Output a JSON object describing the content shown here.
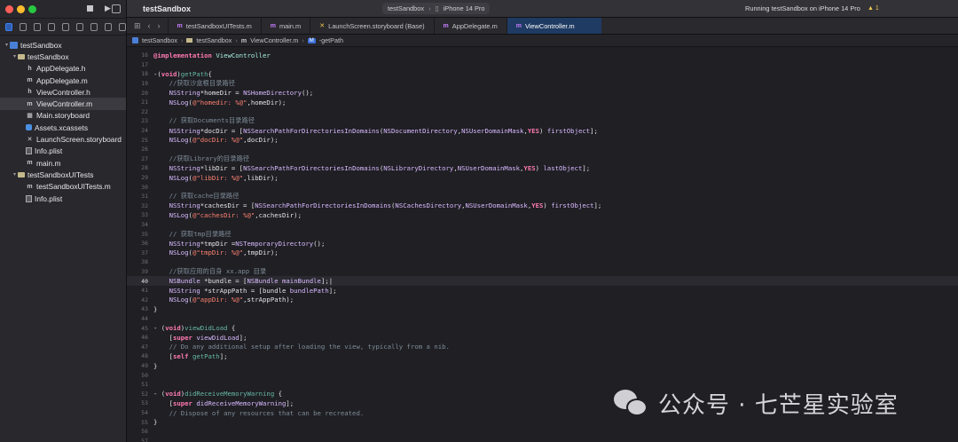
{
  "app": {
    "project_title": "testSandbox",
    "scheme": "testSandbox",
    "device": "iPhone 14 Pro",
    "status": "Running testSandbox on iPhone 14 Pro",
    "warnings": "1"
  },
  "colors": {
    "close": "#ff5f57",
    "minimize": "#febc2e",
    "zoom": "#28c840",
    "active_tab": "#1f3b63",
    "accent": "#3b82f6"
  },
  "navigator": {
    "items": [
      {
        "label": "testSandbox",
        "level": 0,
        "icon": "project-icon",
        "caret": "▾"
      },
      {
        "label": "testSandbox",
        "level": 1,
        "icon": "folder-icon",
        "caret": "▾"
      },
      {
        "label": "AppDelegate.h",
        "level": 2,
        "icon": "h-file-icon",
        "glyph": "h"
      },
      {
        "label": "AppDelegate.m",
        "level": 2,
        "icon": "m-file-icon",
        "glyph": "m"
      },
      {
        "label": "ViewController.h",
        "level": 2,
        "icon": "h-file-icon",
        "glyph": "h"
      },
      {
        "label": "ViewController.m",
        "level": 2,
        "icon": "m-file-icon",
        "glyph": "m",
        "selected": true
      },
      {
        "label": "Main.storyboard",
        "level": 2,
        "icon": "storyboard-icon",
        "glyph": "▦"
      },
      {
        "label": "Assets.xcassets",
        "level": 2,
        "icon": "assets-icon",
        "glyph": ""
      },
      {
        "label": "LaunchScreen.storyboard",
        "level": 2,
        "icon": "launchscreen-icon",
        "glyph": "✕"
      },
      {
        "label": "Info.plist",
        "level": 2,
        "icon": "plist-icon",
        "glyph": ""
      },
      {
        "label": "main.m",
        "level": 2,
        "icon": "m-file-icon",
        "glyph": "m"
      },
      {
        "label": "testSandboxUITests",
        "level": 1,
        "icon": "folder-icon",
        "caret": "▾"
      },
      {
        "label": "testSandboxUITests.m",
        "level": 2,
        "icon": "m-file-icon",
        "glyph": "m"
      },
      {
        "label": "Info.plist",
        "level": 2,
        "icon": "plist-icon",
        "glyph": ""
      }
    ]
  },
  "tabs": [
    {
      "ext": "m",
      "label": "testSandboxUITests.m"
    },
    {
      "ext": "m",
      "label": "main.m"
    },
    {
      "ext": "✕",
      "label": "LaunchScreen.storyboard (Base)"
    },
    {
      "ext": "m",
      "label": "AppDelegate.m"
    },
    {
      "ext": "m",
      "label": "ViewController.m",
      "active": true
    }
  ],
  "jumpbar": {
    "project": "testSandbox",
    "group": "testSandbox",
    "file": "ViewController.m",
    "method_badge": "M",
    "method": "-getPath"
  },
  "editor": {
    "current_line": 40,
    "lines": [
      {
        "n": 16,
        "tokens": [
          [
            "k",
            "@implementation"
          ],
          [
            "plain",
            " "
          ],
          [
            "cls",
            "ViewController"
          ]
        ]
      },
      {
        "n": 17,
        "tokens": []
      },
      {
        "n": 18,
        "tokens": [
          [
            "plain",
            "-("
          ],
          [
            "k",
            "void"
          ],
          [
            "plain",
            ")"
          ],
          [
            "fn",
            "getPath"
          ],
          [
            "plain",
            "{"
          ]
        ]
      },
      {
        "n": 19,
        "tokens": [
          [
            "cm",
            "    //获取沙盒根目录路径"
          ]
        ]
      },
      {
        "n": 20,
        "tokens": [
          [
            "plain",
            "    "
          ],
          [
            "t",
            "NSString"
          ],
          [
            "plain",
            "*homeDir = "
          ],
          [
            "t",
            "NSHomeDirectory"
          ],
          [
            "plain",
            "();"
          ]
        ]
      },
      {
        "n": 21,
        "tokens": [
          [
            "plain",
            "    "
          ],
          [
            "t",
            "NSLog"
          ],
          [
            "plain",
            "("
          ],
          [
            "str",
            "@\"homedir: %@\""
          ],
          [
            "plain",
            ",homeDir);"
          ]
        ]
      },
      {
        "n": 22,
        "tokens": []
      },
      {
        "n": 23,
        "tokens": [
          [
            "cm",
            "    // 获取Documents目录路径"
          ]
        ]
      },
      {
        "n": 24,
        "tokens": [
          [
            "plain",
            "    "
          ],
          [
            "t",
            "NSString"
          ],
          [
            "plain",
            "*docDir = ["
          ],
          [
            "t",
            "NSSearchPathForDirectoriesInDomains"
          ],
          [
            "plain",
            "("
          ],
          [
            "t",
            "NSDocumentDirectory"
          ],
          [
            "plain",
            ","
          ],
          [
            "t",
            "NSUserDomainMask"
          ],
          [
            "plain",
            ","
          ],
          [
            "k",
            "YES"
          ],
          [
            "plain",
            ") "
          ],
          [
            "t",
            "firstObject"
          ],
          [
            "plain",
            "];"
          ]
        ]
      },
      {
        "n": 25,
        "tokens": [
          [
            "plain",
            "    "
          ],
          [
            "t",
            "NSLog"
          ],
          [
            "plain",
            "("
          ],
          [
            "str",
            "@\"docDir: %@\""
          ],
          [
            "plain",
            ",docDir);"
          ]
        ]
      },
      {
        "n": 26,
        "tokens": []
      },
      {
        "n": 27,
        "tokens": [
          [
            "cm",
            "    //获取Library的目录路径"
          ]
        ]
      },
      {
        "n": 28,
        "tokens": [
          [
            "plain",
            "    "
          ],
          [
            "t",
            "NSString"
          ],
          [
            "plain",
            "*libDir = ["
          ],
          [
            "t",
            "NSSearchPathForDirectoriesInDomains"
          ],
          [
            "plain",
            "("
          ],
          [
            "t",
            "NSLibraryDirectory"
          ],
          [
            "plain",
            ","
          ],
          [
            "t",
            "NSUserDomainMask"
          ],
          [
            "plain",
            ","
          ],
          [
            "k",
            "YES"
          ],
          [
            "plain",
            ") "
          ],
          [
            "t",
            "lastObject"
          ],
          [
            "plain",
            "];"
          ]
        ]
      },
      {
        "n": 29,
        "tokens": [
          [
            "plain",
            "    "
          ],
          [
            "t",
            "NSLog"
          ],
          [
            "plain",
            "("
          ],
          [
            "str",
            "@\"libDir: %@\""
          ],
          [
            "plain",
            ",libDir);"
          ]
        ]
      },
      {
        "n": 30,
        "tokens": []
      },
      {
        "n": 31,
        "tokens": [
          [
            "cm",
            "    // 获取cache目录路径"
          ]
        ]
      },
      {
        "n": 32,
        "tokens": [
          [
            "plain",
            "    "
          ],
          [
            "t",
            "NSString"
          ],
          [
            "plain",
            "*cachesDir = ["
          ],
          [
            "t",
            "NSSearchPathForDirectoriesInDomains"
          ],
          [
            "plain",
            "("
          ],
          [
            "t",
            "NSCachesDirectory"
          ],
          [
            "plain",
            ","
          ],
          [
            "t",
            "NSUserDomainMask"
          ],
          [
            "plain",
            ","
          ],
          [
            "k",
            "YES"
          ],
          [
            "plain",
            ") "
          ],
          [
            "t",
            "firstObject"
          ],
          [
            "plain",
            "];"
          ]
        ]
      },
      {
        "n": 33,
        "tokens": [
          [
            "plain",
            "    "
          ],
          [
            "t",
            "NSLog"
          ],
          [
            "plain",
            "("
          ],
          [
            "str",
            "@\"cachesDir: %@\""
          ],
          [
            "plain",
            ",cachesDir);"
          ]
        ]
      },
      {
        "n": 34,
        "tokens": []
      },
      {
        "n": 35,
        "tokens": [
          [
            "cm",
            "    // 获取tmp目录路径"
          ]
        ]
      },
      {
        "n": 36,
        "tokens": [
          [
            "plain",
            "    "
          ],
          [
            "t",
            "NSString"
          ],
          [
            "plain",
            "*tmpDir ="
          ],
          [
            "t",
            "NSTemporaryDirectory"
          ],
          [
            "plain",
            "();"
          ]
        ]
      },
      {
        "n": 37,
        "tokens": [
          [
            "plain",
            "    "
          ],
          [
            "t",
            "NSLog"
          ],
          [
            "plain",
            "("
          ],
          [
            "str",
            "@\"tmpDir: %@\""
          ],
          [
            "plain",
            ",tmpDir);"
          ]
        ]
      },
      {
        "n": 38,
        "tokens": []
      },
      {
        "n": 39,
        "tokens": [
          [
            "cm",
            "    //获取应用的自身 xx.app 目录"
          ]
        ]
      },
      {
        "n": 40,
        "tokens": [
          [
            "plain",
            "    "
          ],
          [
            "t",
            "NSBundle"
          ],
          [
            "plain",
            " *bundle = ["
          ],
          [
            "t",
            "NSBundle"
          ],
          [
            "plain",
            " "
          ],
          [
            "t",
            "mainBundle"
          ],
          [
            "plain",
            "];|"
          ]
        ]
      },
      {
        "n": 41,
        "tokens": [
          [
            "plain",
            "    "
          ],
          [
            "t",
            "NSString"
          ],
          [
            "plain",
            " *strAppPath = [bundle "
          ],
          [
            "t",
            "bundlePath"
          ],
          [
            "plain",
            "];"
          ]
        ]
      },
      {
        "n": 42,
        "tokens": [
          [
            "plain",
            "    "
          ],
          [
            "t",
            "NSLog"
          ],
          [
            "plain",
            "("
          ],
          [
            "str",
            "@\"appDir: %@\""
          ],
          [
            "plain",
            ",strAppPath);"
          ]
        ]
      },
      {
        "n": 43,
        "tokens": [
          [
            "plain",
            "}"
          ]
        ]
      },
      {
        "n": 44,
        "tokens": []
      },
      {
        "n": 45,
        "tokens": [
          [
            "plain",
            "- ("
          ],
          [
            "k",
            "void"
          ],
          [
            "plain",
            ")"
          ],
          [
            "fn",
            "viewDidLoad"
          ],
          [
            "plain",
            " {"
          ]
        ]
      },
      {
        "n": 46,
        "tokens": [
          [
            "plain",
            "    ["
          ],
          [
            "k",
            "super"
          ],
          [
            "plain",
            " "
          ],
          [
            "t",
            "viewDidLoad"
          ],
          [
            "plain",
            "];"
          ]
        ]
      },
      {
        "n": 47,
        "tokens": [
          [
            "cm",
            "    // Do any additional setup after loading the view, typically from a nib."
          ]
        ]
      },
      {
        "n": 48,
        "tokens": [
          [
            "plain",
            "    ["
          ],
          [
            "k",
            "self"
          ],
          [
            "plain",
            " "
          ],
          [
            "fn",
            "getPath"
          ],
          [
            "plain",
            "];"
          ]
        ]
      },
      {
        "n": 49,
        "tokens": [
          [
            "plain",
            "}"
          ]
        ]
      },
      {
        "n": 50,
        "tokens": []
      },
      {
        "n": 51,
        "tokens": []
      },
      {
        "n": 52,
        "tokens": [
          [
            "plain",
            "- ("
          ],
          [
            "k",
            "void"
          ],
          [
            "plain",
            ")"
          ],
          [
            "fn",
            "didReceiveMemoryWarning"
          ],
          [
            "plain",
            " {"
          ]
        ]
      },
      {
        "n": 53,
        "tokens": [
          [
            "plain",
            "    ["
          ],
          [
            "k",
            "super"
          ],
          [
            "plain",
            " "
          ],
          [
            "t",
            "didReceiveMemoryWarning"
          ],
          [
            "plain",
            "];"
          ]
        ]
      },
      {
        "n": 54,
        "tokens": [
          [
            "cm",
            "    // Dispose of any resources that can be recreated."
          ]
        ]
      },
      {
        "n": 55,
        "tokens": [
          [
            "plain",
            "}"
          ]
        ]
      },
      {
        "n": 56,
        "tokens": []
      },
      {
        "n": 57,
        "tokens": []
      }
    ]
  },
  "watermark": {
    "text": "公众号 · 七芒星实验室"
  }
}
